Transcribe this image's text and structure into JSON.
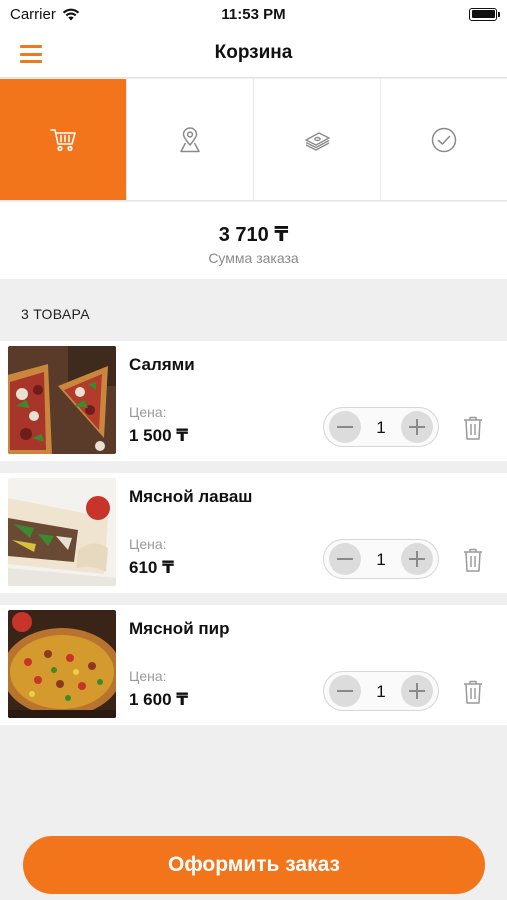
{
  "status": {
    "carrier": "Carrier",
    "time": "11:53 PM"
  },
  "nav": {
    "title": "Корзина"
  },
  "steps": [
    {
      "icon": "cart-icon",
      "active": true
    },
    {
      "icon": "map-pin-icon",
      "active": false
    },
    {
      "icon": "cash-icon",
      "active": false
    },
    {
      "icon": "check-circle-icon",
      "active": false
    }
  ],
  "summary": {
    "total": "3 710 ₸",
    "label": "Сумма заказа"
  },
  "items_count": "3 ТОВАРА",
  "items": [
    {
      "name": "Салями",
      "price_label": "Цена:",
      "price": "1 500 ₸",
      "qty": "1",
      "image": "pizza-salami-photo"
    },
    {
      "name": "Мясной лаваш",
      "price_label": "Цена:",
      "price": "610 ₸",
      "qty": "1",
      "image": "meat-lavash-photo"
    },
    {
      "name": "Мясной пир",
      "price_label": "Цена:",
      "price": "1 600 ₸",
      "qty": "1",
      "image": "meat-feast-pizza-photo"
    }
  ],
  "checkout": {
    "label": "Оформить заказ"
  },
  "colors": {
    "accent": "#f2751b",
    "background": "#efeff0"
  }
}
